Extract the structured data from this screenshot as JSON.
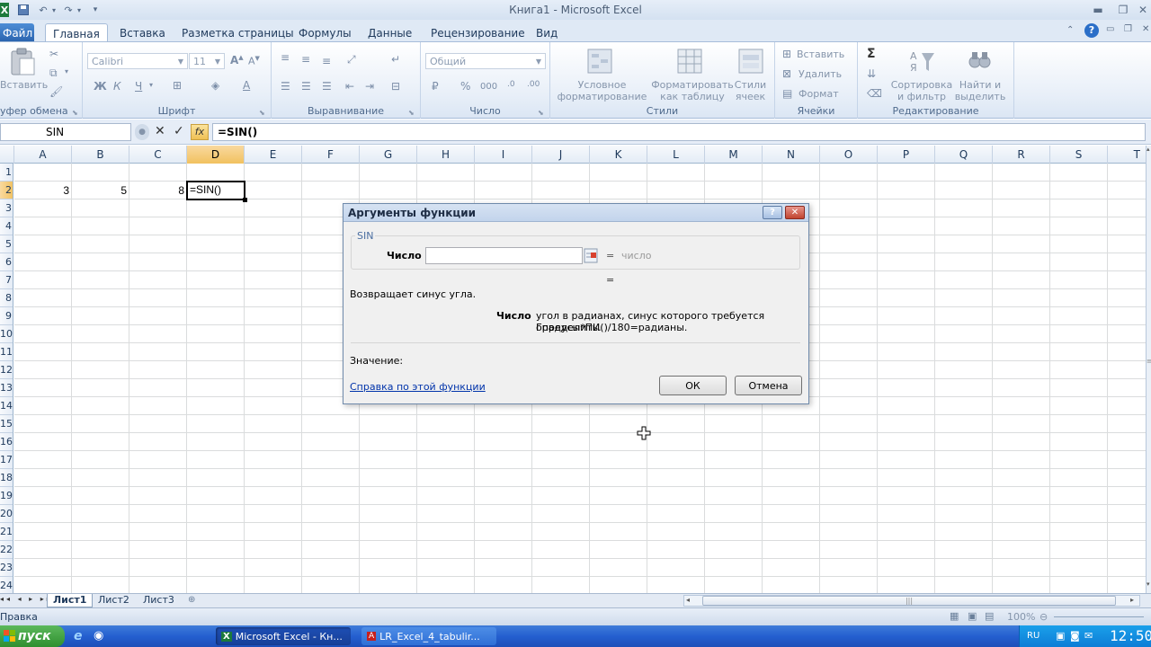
{
  "window": {
    "title": "Книга1 - Microsoft Excel"
  },
  "tabs": [
    "Файл",
    "Главная",
    "Вставка",
    "Разметка страницы",
    "Формулы",
    "Данные",
    "Рецензирование",
    "Вид"
  ],
  "ribbon": {
    "clipboard": {
      "paste": "Вставить",
      "label": "уфер обмена"
    },
    "font": {
      "name": "Calibri",
      "size": "11",
      "bold": "Ж",
      "italic": "К",
      "underline": "Ч",
      "label": "Шрифт"
    },
    "alignment": {
      "label": "Выравнивание"
    },
    "number": {
      "format": "Общий",
      "percent": "%",
      "thousands": "000",
      "label": "Число"
    },
    "styles": {
      "conditional_1": "Условное",
      "conditional_2": "форматирование",
      "table_1": "Форматировать",
      "table_2": "как таблицу",
      "cell_1": "Стили",
      "cell_2": "ячеек",
      "label": "Стили"
    },
    "cells": {
      "insert": "Вставить",
      "delete": "Удалить",
      "format": "Формат",
      "label": "Ячейки"
    },
    "editing": {
      "sort_1": "Сортировка",
      "sort_2": "и фильтр",
      "find_1": "Найти и",
      "find_2": "выделить",
      "label": "Редактирование"
    }
  },
  "formula_bar": {
    "name_box": "SIN",
    "fx": "fx",
    "formula": "=SIN()"
  },
  "grid": {
    "columns": [
      "A",
      "B",
      "C",
      "D",
      "E",
      "F",
      "G",
      "H",
      "I",
      "J",
      "K",
      "L",
      "M",
      "N",
      "O",
      "P",
      "Q",
      "R",
      "S",
      "T"
    ],
    "rows": [
      "1",
      "2",
      "3",
      "4",
      "5",
      "6",
      "7",
      "8",
      "9",
      "10",
      "11",
      "12",
      "13",
      "14",
      "15",
      "16",
      "17",
      "18",
      "19",
      "20",
      "21",
      "22",
      "23",
      "24"
    ],
    "cells": {
      "A2": "3",
      "B2": "5",
      "C2": "8",
      "D2": "=SIN()"
    }
  },
  "sheets": [
    "Лист1",
    "Лист2",
    "Лист3"
  ],
  "status": {
    "left": "Правка",
    "zoom": "100%"
  },
  "taskbar": {
    "start": "пуск",
    "task1": "Microsoft Excel - Кн...",
    "task2": "LR_Excel_4_tabulir...",
    "lang": "RU",
    "time": "12:50"
  },
  "dialog": {
    "title": "Аргументы функции",
    "help_btn": "?",
    "function": "SIN",
    "arg_label": "Число",
    "arg_value": "",
    "equals": "=",
    "arg_hint": "число",
    "equals2": "=",
    "description": "Возвращает синус угла.",
    "arg_desc_label": "Число",
    "arg_desc_line1": "угол в радианах, синус которого требуется определить.",
    "arg_desc_line2": "Градусы*ПИ()/180=радианы.",
    "value_label": "Значение:",
    "help_link": "Справка по этой функции",
    "ok": "ОК",
    "cancel": "Отмена"
  },
  "colors": {
    "accent": "#2a63ad",
    "selection": "#f1c15f",
    "ribbon_bg": "#e8eff8",
    "taskbar": "#245fd0"
  },
  "icons": [
    "excel-icon",
    "save-icon",
    "undo-icon",
    "redo-icon",
    "minimize-icon",
    "maximize-icon",
    "close-icon",
    "help-icon",
    "paste-icon",
    "cut-icon",
    "copy-icon",
    "format-painter-icon",
    "sum-icon",
    "sort-filter-icon",
    "find-icon",
    "function-icon",
    "cancel-icon",
    "enter-icon",
    "collapse-dialog-icon",
    "cursor-icon",
    "windows-logo-icon",
    "ie-icon",
    "pdf-icon",
    "clock-icon"
  ]
}
